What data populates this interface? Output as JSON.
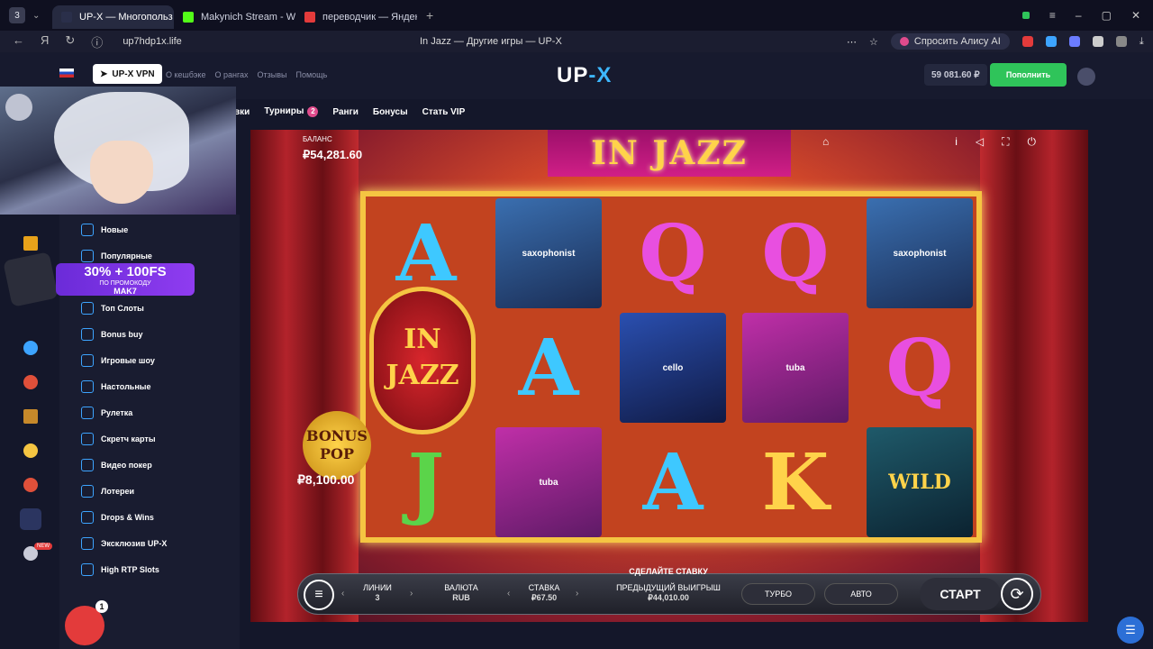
{
  "browser": {
    "tab_count": "3",
    "tabs": [
      {
        "label": "UP-X — Многопольз",
        "active": true
      },
      {
        "label": "Makynich Stream - Watch",
        "active": false
      },
      {
        "label": "переводчик — Яндекс: на",
        "active": false
      }
    ],
    "url": "up7hdp1x.life",
    "page_title": "In Jazz — Другие игры — UP-X",
    "alice_label": "Спросить Алису AI"
  },
  "site": {
    "vpn_label": "UP-X VPN",
    "top_links": [
      "О кешбэке",
      "О рангах",
      "Отзывы",
      "Помощь"
    ],
    "logo_main": "UP",
    "logo_accent": "-X",
    "balance": "59 081.60 ₽",
    "deposit_label": "Пополнить"
  },
  "game_nav": {
    "items": [
      "вки",
      "Турниры",
      "Ранги",
      "Бонусы",
      "Стать VIP"
    ],
    "tournament_badge": "2"
  },
  "sidebar": {
    "items": [
      "Новые",
      "Популярные",
      "Топ Слоты",
      "Bonus buy",
      "Игровые шоу",
      "Настольные",
      "Рулетка",
      "Скретч карты",
      "Видео покер",
      "Лотереи",
      "Drops & Wins",
      "Эксклюзив UP-X",
      "High RTP Slots"
    ]
  },
  "promo": {
    "headline": "30% + 100FS",
    "subline": "ПО ПРОМОКОДУ",
    "code": "MAK7"
  },
  "notification_count": "1",
  "rail_new_badge": "NEW",
  "game": {
    "title": "IN JAZZ",
    "balance_label": "БАЛАНС",
    "balance_value": "₽54,281.60",
    "bonus_pop_line1": "BONUS",
    "bonus_pop_line2": "POP",
    "bonus_pop_value": "₽8,100.00",
    "logo_line1": "IN",
    "logo_line2": "JAZZ",
    "reels": [
      [
        "A",
        "",
        "J"
      ],
      [
        "saxophonist",
        "A",
        "tuba"
      ],
      [
        "Q",
        "cello",
        "A"
      ],
      [
        "Q",
        "tuba",
        "K"
      ],
      [
        "saxophonist",
        "Q",
        "WILD"
      ]
    ],
    "controls": {
      "lines_label": "ЛИНИИ",
      "lines_value": "3",
      "currency_label": "ВАЛЮТА",
      "currency_value": "RUB",
      "bet_label": "СТАВКА",
      "bet_value": "₽67.50",
      "prompt": "СДЕЛАЙТЕ СТАВКУ",
      "prev_win_label": "ПРЕДЫДУЩИЙ ВЫИГРЫШ",
      "prev_win_value": "₽44,010.00",
      "turbo_label": "ТУРБО",
      "auto_label": "АВТО",
      "start_label": "СТАРТ"
    }
  },
  "colors": {
    "accent_green": "#2fc45a",
    "accent_blue": "#3da4ff",
    "promo_purple": "#7b33e4",
    "title_gold": "#ffd34a"
  }
}
